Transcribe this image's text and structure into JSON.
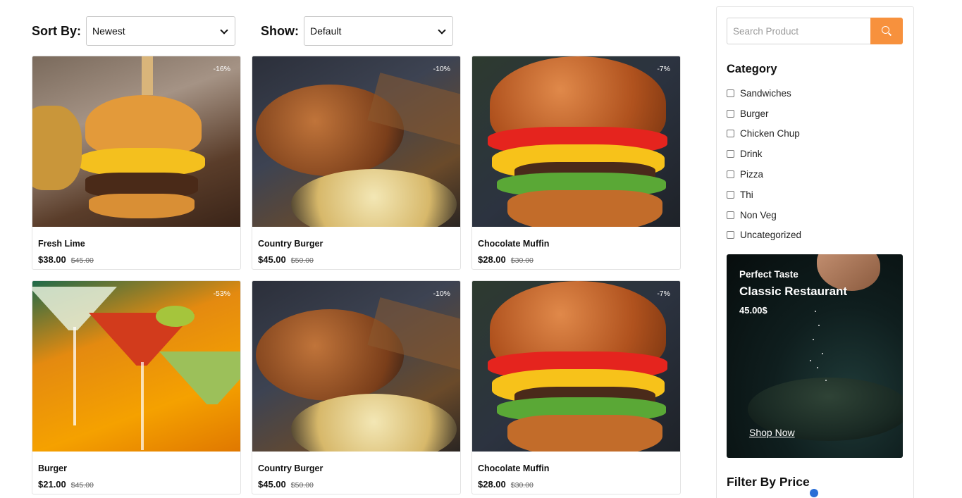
{
  "toolbar": {
    "sort_label": "Sort By:",
    "sort_value": "Newest",
    "show_label": "Show:",
    "show_value": "Default"
  },
  "products": [
    {
      "name": "Fresh Lime",
      "price": "$38.00",
      "old_price": "$45.00",
      "discount": "-16%"
    },
    {
      "name": "Country Burger",
      "price": "$45.00",
      "old_price": "$50.00",
      "discount": "-10%"
    },
    {
      "name": "Chocolate Muffin",
      "price": "$28.00",
      "old_price": "$30.00",
      "discount": "-7%"
    },
    {
      "name": "Burger",
      "price": "$21.00",
      "old_price": "$45.00",
      "discount": "-53%"
    },
    {
      "name": "Country Burger",
      "price": "$45.00",
      "old_price": "$50.00",
      "discount": "-10%"
    },
    {
      "name": "Chocolate Muffin",
      "price": "$28.00",
      "old_price": "$30.00",
      "discount": "-7%"
    }
  ],
  "sidebar": {
    "search_placeholder": "Search Product",
    "category_title": "Category",
    "categories": [
      "Sandwiches",
      "Burger",
      "Chicken Chup",
      "Drink",
      "Pizza",
      "Thi",
      "Non Veg",
      "Uncategorized"
    ],
    "promo": {
      "subtitle": "Perfect Taste",
      "title": "Classic Restaurant",
      "price": "45.00$",
      "link": "Shop Now"
    },
    "filter_title": "Filter By Price"
  },
  "colors": {
    "accent": "#f7913d",
    "slider": "#2a6fd6"
  }
}
